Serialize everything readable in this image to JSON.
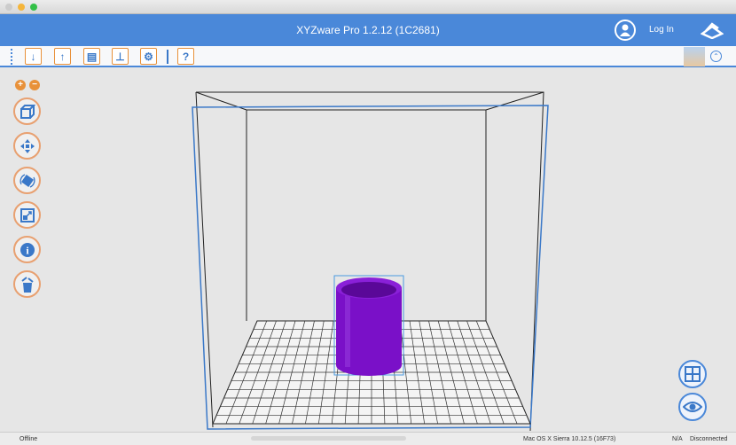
{
  "window": {
    "title": "XYZware Pro 1.2.12 (1C2681)"
  },
  "header": {
    "login_label": "Log In"
  },
  "toolbar": {
    "items": [
      {
        "name": "import",
        "glyph": "↓"
      },
      {
        "name": "export",
        "glyph": "↑"
      },
      {
        "name": "save",
        "glyph": "▤"
      },
      {
        "name": "print",
        "glyph": "⊥"
      },
      {
        "name": "settings",
        "glyph": "⚙"
      },
      {
        "name": "help",
        "glyph": "?"
      }
    ]
  },
  "side": {
    "zoom_in": "+",
    "zoom_out": "−"
  },
  "status": {
    "connection": "Offline",
    "os": "Mac OS X Sierra 10.12.5 (16F73)",
    "na": "N/A",
    "printer": "Disconnected"
  },
  "colors": {
    "accent": "#4a88d9",
    "orange": "#e8913a",
    "model": "#7a10c8"
  }
}
